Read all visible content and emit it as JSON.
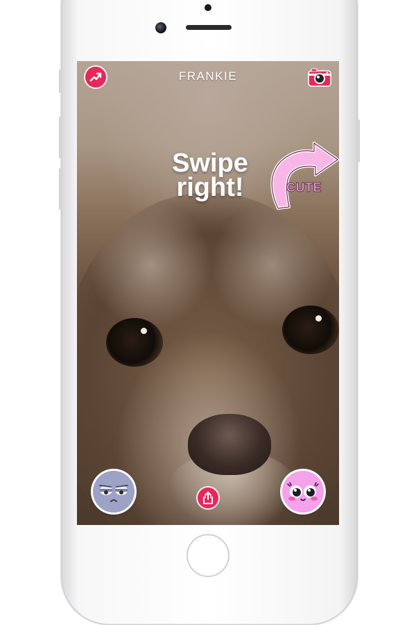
{
  "header": {
    "title": "FRANKIE"
  },
  "overlay": {
    "swipe_line1": "Swipe",
    "swipe_line2": "right!",
    "arrow_label": "CUTE"
  },
  "icons": {
    "trending": "trending-up-icon",
    "camera": "camera-icon",
    "share": "share-icon",
    "not_cute": "sleepy-face-icon",
    "cute": "cute-face-icon"
  },
  "colors": {
    "accent": "#e6285c",
    "cute_pink": "#f4a2ec",
    "not_cute_lavender": "#9ea2c6"
  }
}
